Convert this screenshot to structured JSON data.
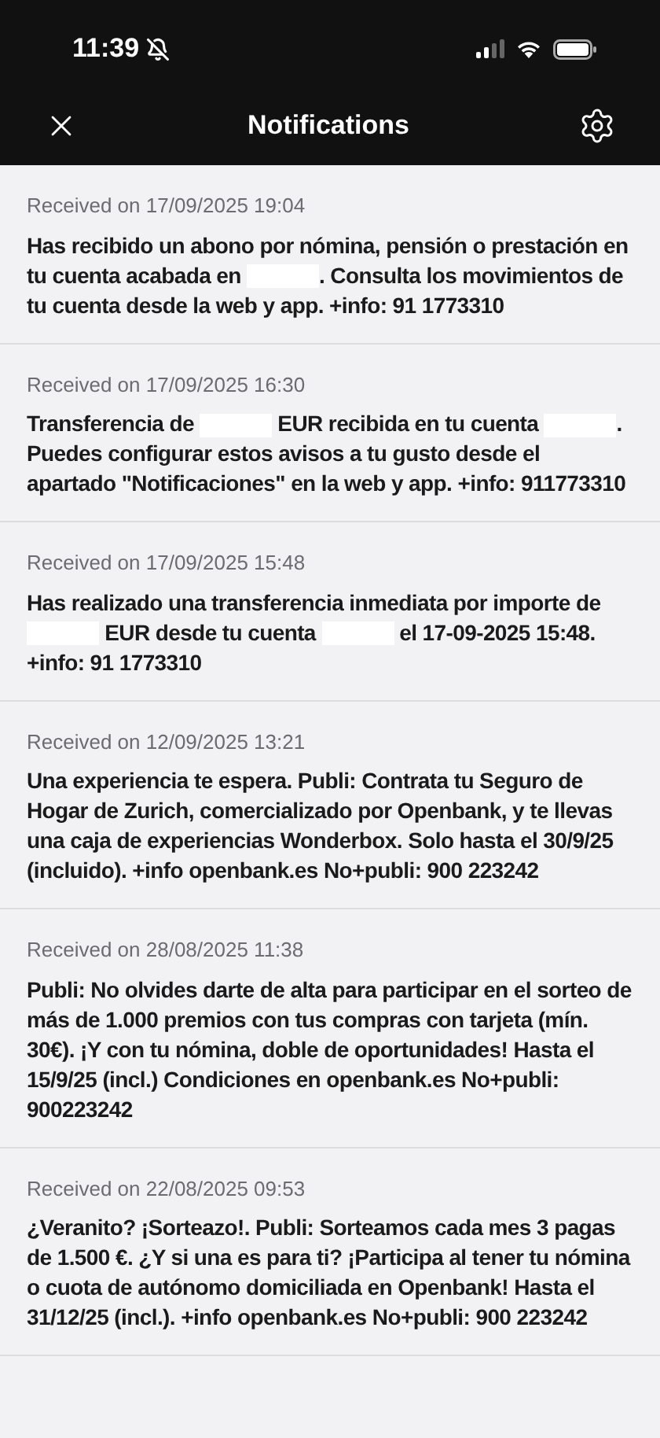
{
  "status_bar": {
    "time": "11:39"
  },
  "header": {
    "title": "Notifications"
  },
  "notifications": [
    {
      "received": "Received on 17/09/2025 19:04",
      "message": [
        {
          "kind": "text",
          "text": "Has recibido un abono por nómina, pensión o prestación en tu cuenta acabada en "
        },
        {
          "kind": "redacted"
        },
        {
          "kind": "text",
          "text": ". Consulta los movimientos de tu cuenta desde la web y app. +info: 91 1773310"
        }
      ]
    },
    {
      "received": "Received on 17/09/2025 16:30",
      "message": [
        {
          "kind": "text",
          "text": "Transferencia de "
        },
        {
          "kind": "redacted"
        },
        {
          "kind": "text",
          "text": " EUR recibida en tu cuenta "
        },
        {
          "kind": "redacted"
        },
        {
          "kind": "text",
          "text": ". Puedes configurar estos avisos a tu gusto desde el apartado \"Notificaciones\" en la web y app. +info: 911773310"
        }
      ]
    },
    {
      "received": "Received on 17/09/2025 15:48",
      "message": [
        {
          "kind": "text",
          "text": "Has realizado una transferencia inmediata por importe de "
        },
        {
          "kind": "redacted"
        },
        {
          "kind": "text",
          "text": " EUR desde tu cuenta "
        },
        {
          "kind": "redacted"
        },
        {
          "kind": "text",
          "text": " el 17-09-2025 15:48. +info: 91 1773310"
        }
      ]
    },
    {
      "received": "Received on 12/09/2025 13:21",
      "message": [
        {
          "kind": "text",
          "text": "Una experiencia te espera. Publi: Contrata tu Seguro de Hogar de Zurich, comercializado por Openbank, y te llevas una caja de experiencias Wonderbox. Solo hasta el 30/9/25 (incluido). +info openbank.es No+publi: 900 223242"
        }
      ]
    },
    {
      "received": "Received on 28/08/2025 11:38",
      "message": [
        {
          "kind": "text",
          "text": "Publi: No olvides darte de alta para participar en el sorteo de más de 1.000 premios con tus compras con tarjeta (mín. 30€). ¡Y con tu nómina, doble de oportunidades! Hasta el 15/9/25 (incl.) Condiciones en openbank.es No+publi: 900223242"
        }
      ]
    },
    {
      "received": "Received on 22/08/2025 09:53",
      "message": [
        {
          "kind": "text",
          "text": "¿Veranito? ¡Sorteazo!. Publi: Sorteamos cada mes 3 pagas de 1.500 €. ¿Y si una es para ti? ¡Participa al tener tu nómina o cuota de autónomo domiciliada en Openbank! Hasta el 31/12/25 (incl.). +info openbank.es No+publi: 900 223242"
        }
      ]
    }
  ]
}
